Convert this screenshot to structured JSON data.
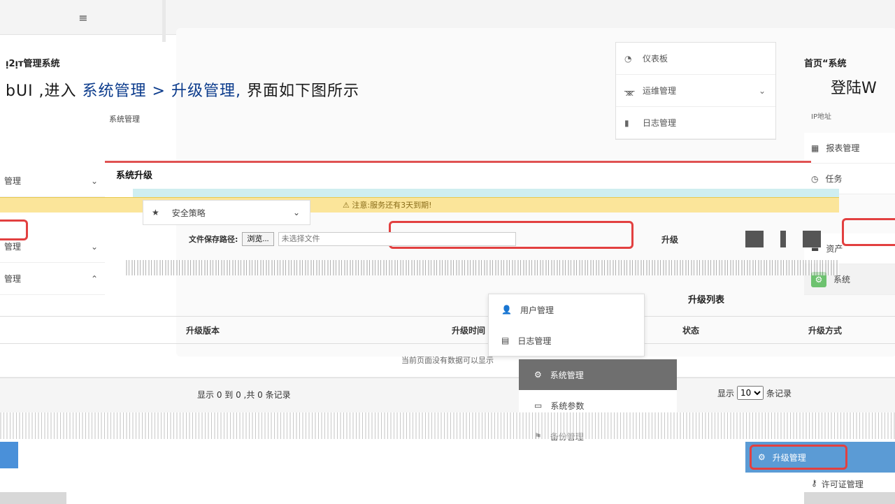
{
  "header": {
    "menu_icon": "hamburger-icon"
  },
  "doc": {
    "title": "ᴉ2ᴉᴛ管理系统",
    "heading_prefix": "bUI ,进入",
    "heading_link": "系统管理 > 升级管理,",
    "heading_suffix": "界面如下图所示"
  },
  "right_doc": {
    "title": "首页“系统",
    "login": "登陆W",
    "sub": "IP地址"
  },
  "top_menu": {
    "items": [
      {
        "label": "仪表板",
        "icon": "dashboard-icon"
      },
      {
        "label": "运维管理",
        "icon": "sitemap-icon"
      },
      {
        "label": "日志管理",
        "icon": "log-icon"
      }
    ]
  },
  "breadcrumb": "系统管理",
  "right_menu": {
    "items": [
      {
        "label": "报表管理",
        "icon": "report-icon"
      },
      {
        "label": "任务",
        "icon": "clock-icon"
      },
      {
        "label": "资产",
        "icon": "asset-icon"
      },
      {
        "label": "系统",
        "icon": "gear-icon"
      }
    ]
  },
  "left_menu": {
    "items": [
      {
        "label": "管理",
        "chevron": "⌄"
      },
      {
        "label": "管理",
        "chevron": "⌄"
      },
      {
        "label": "管理",
        "chevron": "⌃"
      }
    ]
  },
  "system_card": {
    "title": "系统升级"
  },
  "warning": {
    "text": "注意:服务还有3天到期!"
  },
  "strategy_dropdown": {
    "label": "安全策略",
    "icon": "star-icon"
  },
  "upload": {
    "label": "文件保存路径:",
    "browse": "浏览...",
    "placeholder": "未选择文件",
    "submit": "升级"
  },
  "upgrade_list": {
    "title": "升级列表",
    "columns": [
      "",
      "升级版本",
      "升级时间",
      "状态",
      "升级方式"
    ],
    "empty_text": "当前页面没有数据可以显示",
    "showing": "显示 0 到 0 ,共 0 条记录",
    "page_size_prefix": "显示",
    "page_size": "10",
    "page_size_suffix": "条记录"
  },
  "user_menu": {
    "items": [
      {
        "label": "用户管理",
        "icon": "user-icon"
      },
      {
        "label": "日志管理",
        "icon": "log-icon"
      }
    ],
    "sub_items": [
      {
        "label": "系统管理",
        "icon": "gear-icon"
      },
      {
        "label": "系统参数",
        "icon": "params-icon"
      },
      {
        "label": "备份管理",
        "icon": "backup-icon"
      }
    ]
  },
  "active_item": {
    "label": "升级管理",
    "icon": "gear-icon"
  },
  "license_item": {
    "label": "许可证管理",
    "icon": "key-icon"
  },
  "colors": {
    "accent_blue": "#5b9bd5",
    "warning_bg": "#fbe59a",
    "highlight_red": "#e24040",
    "success_green": "#6dc26f"
  }
}
